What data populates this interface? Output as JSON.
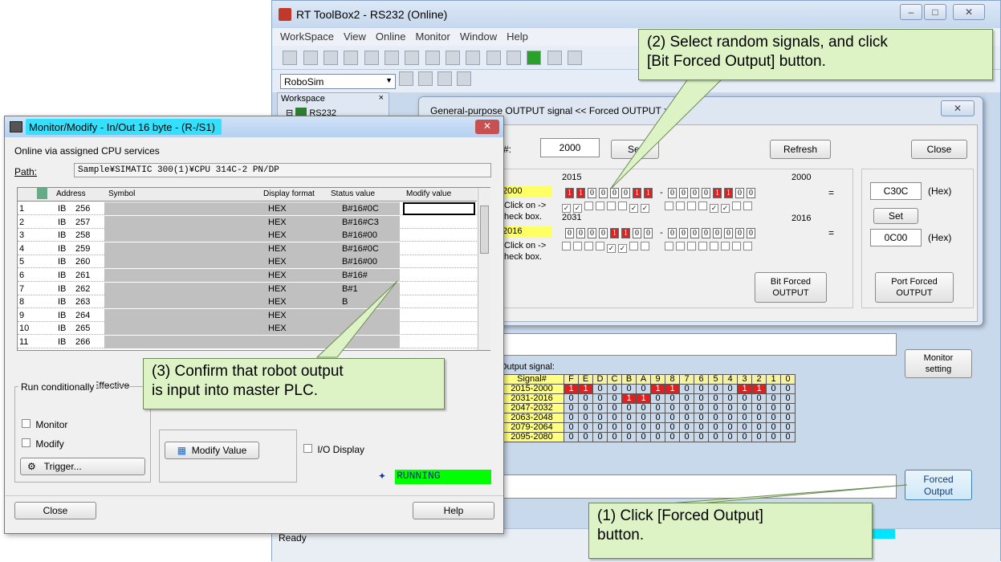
{
  "rt": {
    "title": "RT ToolBox2 - RS232  (Online)",
    "menu": [
      "WorkSpace",
      "View",
      "Online",
      "Monitor",
      "Window",
      "Help"
    ],
    "robot_select": "RoboSim",
    "workspace_label": "Workspace",
    "workspace_item": "RS232",
    "status": "Ready",
    "output_signal_label": "Output signal:",
    "monitor_setting": [
      "Monitor",
      "setting"
    ],
    "forced_output": [
      "Forced",
      "Output"
    ]
  },
  "gp": {
    "title": "General-purpose OUTPUT signal  << Forced OUTPUT >>",
    "no_label": "#:",
    "no_value": "2000",
    "set": "Set",
    "refresh": "Refresh",
    "close": "Close",
    "r1_hi": "2015",
    "r1_lo": "2000",
    "r1_label": "2000",
    "r1_bits": [
      "1",
      "1",
      "0",
      "0",
      "0",
      "0",
      "1",
      "1",
      "0",
      "0",
      "0",
      "0",
      "1",
      "1",
      "0",
      "0"
    ],
    "r1_hex": "C30C",
    "r2_hi": "2031",
    "r2_lo": "2016",
    "r2_label": "2016",
    "r2_bits": [
      "0",
      "0",
      "0",
      "0",
      "1",
      "1",
      "0",
      "0",
      "0",
      "0",
      "0",
      "0",
      "0",
      "0",
      "0",
      "0"
    ],
    "r2_hex": "0C00",
    "click_on": "Click on ->",
    "check_box": "heck box.",
    "eq": "=",
    "hex_unit": "(Hex)",
    "bit_forced": [
      "Bit Forced",
      "OUTPUT"
    ],
    "port_forced": [
      "Port Forced",
      "OUTPUT"
    ]
  },
  "sig": {
    "header": [
      "Signal#",
      "F",
      "E",
      "D",
      "C",
      "B",
      "A",
      "9",
      "8",
      "7",
      "6",
      "5",
      "4",
      "3",
      "2",
      "1",
      "0"
    ],
    "rows": [
      {
        "label": "2015-2000",
        "bits": [
          1,
          1,
          0,
          0,
          0,
          0,
          1,
          1,
          0,
          0,
          0,
          0,
          1,
          1,
          0,
          0
        ]
      },
      {
        "label": "2031-2016",
        "bits": [
          0,
          0,
          0,
          0,
          1,
          1,
          0,
          0,
          0,
          0,
          0,
          0,
          0,
          0,
          0,
          0
        ]
      },
      {
        "label": "2047-2032",
        "bits": [
          0,
          0,
          0,
          0,
          0,
          0,
          0,
          0,
          0,
          0,
          0,
          0,
          0,
          0,
          0,
          0
        ]
      },
      {
        "label": "2063-2048",
        "bits": [
          0,
          0,
          0,
          0,
          0,
          0,
          0,
          0,
          0,
          0,
          0,
          0,
          0,
          0,
          0,
          0
        ]
      },
      {
        "label": "2079-2064",
        "bits": [
          0,
          0,
          0,
          0,
          0,
          0,
          0,
          0,
          0,
          0,
          0,
          0,
          0,
          0,
          0,
          0
        ]
      },
      {
        "label": "2095-2080",
        "bits": [
          0,
          0,
          0,
          0,
          0,
          0,
          0,
          0,
          0,
          0,
          0,
          0,
          0,
          0,
          0,
          0
        ]
      }
    ]
  },
  "mm": {
    "title": "Monitor/Modify - In/Out  16 byte - (R-/S1)",
    "online": "Online via assigned CPU services",
    "path_label": "Path:",
    "path_value": "Sample¥SIMATIC 300(1)¥CPU 314C-2 PN/DP",
    "cols": [
      "Address",
      "Symbol",
      "Display format",
      "Status value",
      "Modify value"
    ],
    "rows": [
      {
        "n": "1",
        "a": "IB",
        "b": "256",
        "f": "HEX",
        "s": "B#16#0C"
      },
      {
        "n": "2",
        "a": "IB",
        "b": "257",
        "f": "HEX",
        "s": "B#16#C3"
      },
      {
        "n": "3",
        "a": "IB",
        "b": "258",
        "f": "HEX",
        "s": "B#16#00"
      },
      {
        "n": "4",
        "a": "IB",
        "b": "259",
        "f": "HEX",
        "s": "B#16#0C"
      },
      {
        "n": "5",
        "a": "IB",
        "b": "260",
        "f": "HEX",
        "s": "B#16#00"
      },
      {
        "n": "6",
        "a": "IB",
        "b": "261",
        "f": "HEX",
        "s": "B#16#"
      },
      {
        "n": "7",
        "a": "IB",
        "b": "262",
        "f": "HEX",
        "s": "B#1"
      },
      {
        "n": "8",
        "a": "IB",
        "b": "263",
        "f": "HEX",
        "s": "B"
      },
      {
        "n": "9",
        "a": "IB",
        "b": "264",
        "f": "HEX",
        "s": ""
      },
      {
        "n": "10",
        "a": "IB",
        "b": "265",
        "f": "HEX",
        "s": ""
      },
      {
        "n": "11",
        "a": "IB",
        "b": "266",
        "f": "",
        "s": ""
      }
    ],
    "row_not_effective": "Row Not Effective",
    "run_cond": "Run conditionally",
    "monitor": "Monitor",
    "modify": "Modify",
    "trigger": "Trigger...",
    "modify_value": "Modify Value",
    "io_display": "I/O Display",
    "running": "RUNNING",
    "close": "Close",
    "help": "Help"
  },
  "callouts": {
    "c1": [
      "(1)  Click [Forced Output]",
      "       button."
    ],
    "c2": [
      "(2)  Select random signals, and click",
      "      [Bit Forced Output] button."
    ],
    "c3": [
      "(3)  Confirm that robot output",
      "      is input into master PLC."
    ]
  }
}
